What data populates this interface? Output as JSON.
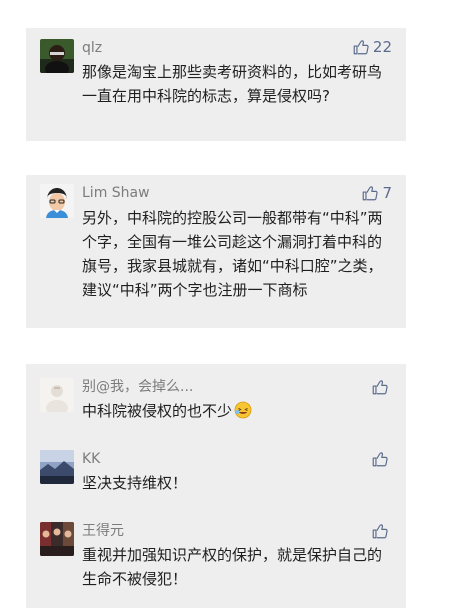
{
  "cards": [
    {
      "comments": [
        {
          "name": "qlz",
          "likes": "22",
          "text": "那像是淘宝上那些卖考研资料的，比如考研鸟一直在用中科院的标志，算是侵权吗?",
          "avatar_icon": "person-avatar-dark-icon"
        }
      ]
    },
    {
      "comments": [
        {
          "name": "Lim Shaw",
          "likes": "7",
          "text": "另外，中科院的控股公司一般都带有“中科”两个字，全国有一堆公司趁这个漏洞打着中科的旗号，我家县城就有，诸如“中科口腔”之类，建议“中科”两个字也注册一下商标",
          "avatar_icon": "cartoon-avatar-icon"
        }
      ]
    },
    {
      "comments": [
        {
          "name": "别@我，会掉么...",
          "likes": "",
          "text": "中科院被侵权的也不少",
          "emoji": "laughing-emoji-icon",
          "avatar_icon": "light-avatar-icon"
        },
        {
          "name": "KK",
          "likes": "",
          "text": "坚决支持维权！",
          "avatar_icon": "landscape-avatar-icon"
        },
        {
          "name": "王得元",
          "likes": "",
          "text": "重视并加强知识产权的保护，就是保护自己的生命不被侵犯！",
          "avatar_icon": "group-photo-avatar-icon"
        }
      ]
    }
  ],
  "colors": {
    "card_bg": "#eeeeee",
    "name": "#7c7c7c",
    "text": "#1f1f1f",
    "like": "#5b6b8c"
  }
}
